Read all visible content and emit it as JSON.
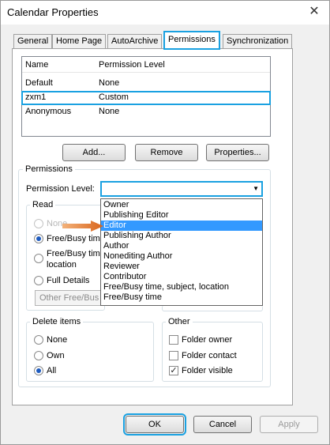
{
  "window": {
    "title": "Calendar Properties",
    "close_glyph": "✕"
  },
  "tabs": [
    {
      "label": "General"
    },
    {
      "label": "Home Page"
    },
    {
      "label": "AutoArchive"
    },
    {
      "label": "Permissions",
      "active": true
    },
    {
      "label": "Synchronization"
    }
  ],
  "permissions_list": {
    "headers": [
      "Name",
      "Permission Level"
    ],
    "rows": [
      {
        "name": "Default",
        "level": "None"
      },
      {
        "name": "zxm1",
        "level": "Custom",
        "selected": true
      },
      {
        "name": "Anonymous",
        "level": "None"
      }
    ]
  },
  "list_buttons": {
    "add": "Add...",
    "remove": "Remove",
    "properties": "Properties..."
  },
  "permissions_group": {
    "label": "Permissions",
    "level_label": "Permission Level:",
    "level_value": ""
  },
  "dropdown_options": [
    "Owner",
    "Publishing Editor",
    "Editor",
    "Publishing Author",
    "Author",
    "Nonediting Author",
    "Reviewer",
    "Contributor",
    "Free/Busy time, subject, location",
    "Free/Busy time"
  ],
  "dropdown_selected_index": 2,
  "read_group": {
    "label": "Read",
    "options": [
      "None",
      "Free/Busy tim",
      "Free/Busy tim",
      "location",
      "Full Details"
    ],
    "other_free_busy": "Other Free/Bus"
  },
  "delete_group": {
    "label": "Delete items",
    "options": [
      "None",
      "Own",
      "All"
    ],
    "selected": "All"
  },
  "other_group": {
    "label": "Other",
    "items": [
      {
        "label": "Folder owner",
        "checked": false
      },
      {
        "label": "Folder contact",
        "checked": false
      },
      {
        "label": "Folder visible",
        "checked": true
      }
    ]
  },
  "footer": {
    "ok": "OK",
    "cancel": "Cancel",
    "apply": "Apply"
  },
  "colors": {
    "highlight": "#1aa1e1",
    "selection": "#3399ff",
    "arrow": "#e07a2e"
  }
}
